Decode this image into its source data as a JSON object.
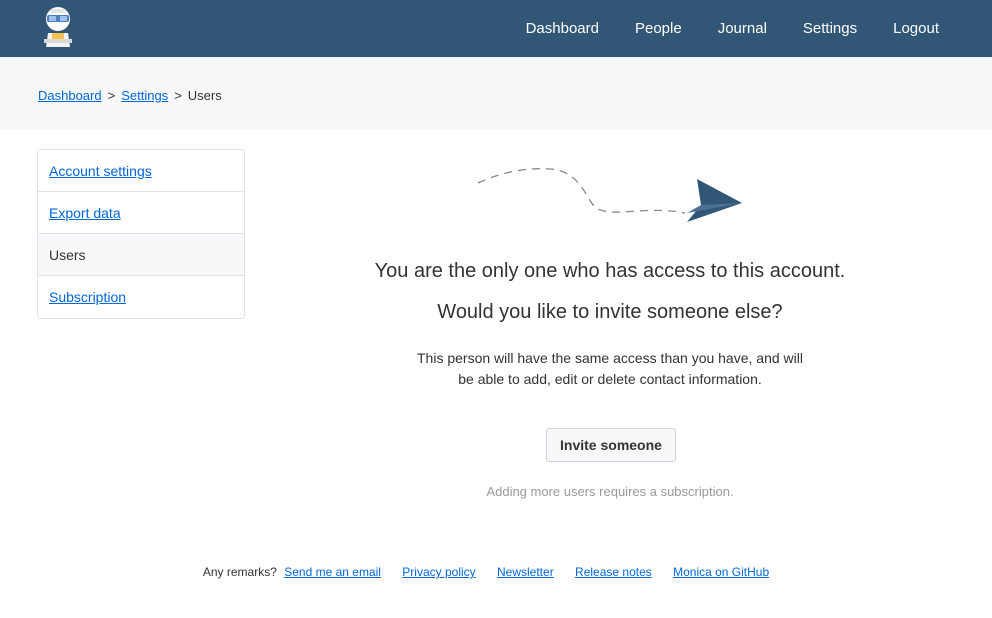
{
  "nav": {
    "items": [
      "Dashboard",
      "People",
      "Journal",
      "Settings",
      "Logout"
    ]
  },
  "breadcrumb": {
    "items": [
      "Dashboard",
      "Settings"
    ],
    "current": "Users",
    "separator": ">"
  },
  "sidebar": {
    "items": [
      {
        "label": "Account settings"
      },
      {
        "label": "Export data"
      },
      {
        "label": "Users"
      },
      {
        "label": "Subscription"
      }
    ]
  },
  "main": {
    "headline1": "You are the only one who has access to this account.",
    "headline2": "Would you like to invite someone else?",
    "description": "This person will have the same access than you have, and will be able to add, edit or delete contact information.",
    "invite_button": "Invite someone",
    "subscription_note": "Adding more users requires a subscription."
  },
  "footer": {
    "remark": "Any remarks?",
    "links": [
      "Send me an email",
      "Privacy policy",
      "Newsletter",
      "Release notes",
      "Monica on GitHub"
    ]
  },
  "colors": {
    "topbar": "#325776",
    "link": "#0366d6",
    "plane": "#325776"
  }
}
